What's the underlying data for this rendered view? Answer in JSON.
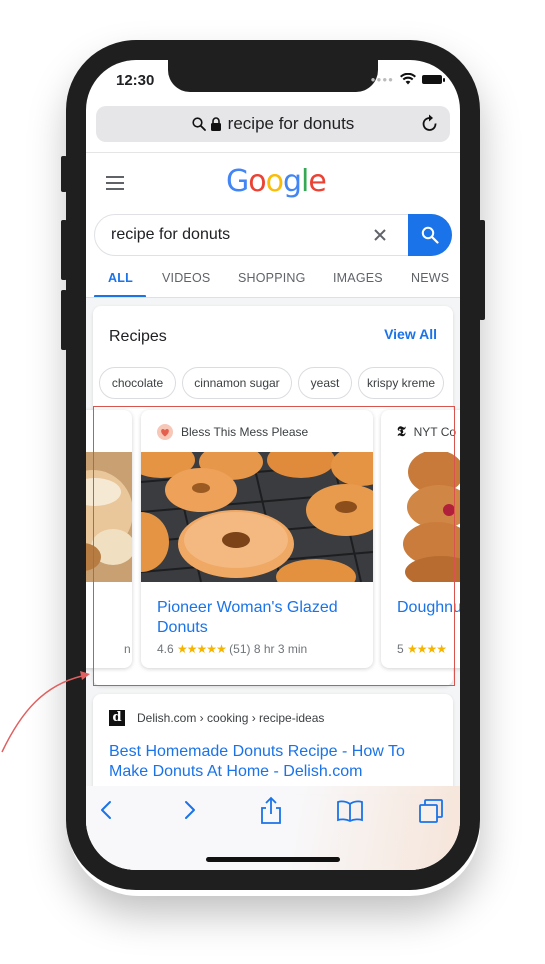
{
  "status": {
    "time": "12:30"
  },
  "url_bar": {
    "text": "recipe for donuts"
  },
  "search": {
    "query": "recipe for donuts"
  },
  "tabs": [
    {
      "label": "ALL",
      "active": true
    },
    {
      "label": "VIDEOS"
    },
    {
      "label": "SHOPPING"
    },
    {
      "label": "IMAGES"
    },
    {
      "label": "NEWS"
    }
  ],
  "recipes": {
    "title": "Recipes",
    "view_all": "View All",
    "chips": [
      "chocolate",
      "cinnamon sugar",
      "yeast",
      "krispy kreme"
    ],
    "cards": [
      {
        "source": "Bless This Mess Please",
        "title": "Pioneer Woman's Glazed Donuts",
        "rating": "4.6",
        "stars": "★★★★★",
        "reviews": "(51)",
        "time": "8 hr 3 min"
      },
      {
        "source": "NYT Co",
        "title": "Doughnu",
        "rating": "5",
        "stars": "★★★★"
      }
    ],
    "left_card_fragment": "n"
  },
  "result": {
    "favicon_letter": "d",
    "breadcrumb": "Delish.com › cooking › recipe-ideas",
    "title": "Best Homemade Donuts Recipe - How To Make Donuts At Home - Delish.com"
  },
  "colors": {
    "link_blue": "#1a73e8",
    "highlight_red": "#d9534f",
    "star_yellow": "#f4b400"
  }
}
